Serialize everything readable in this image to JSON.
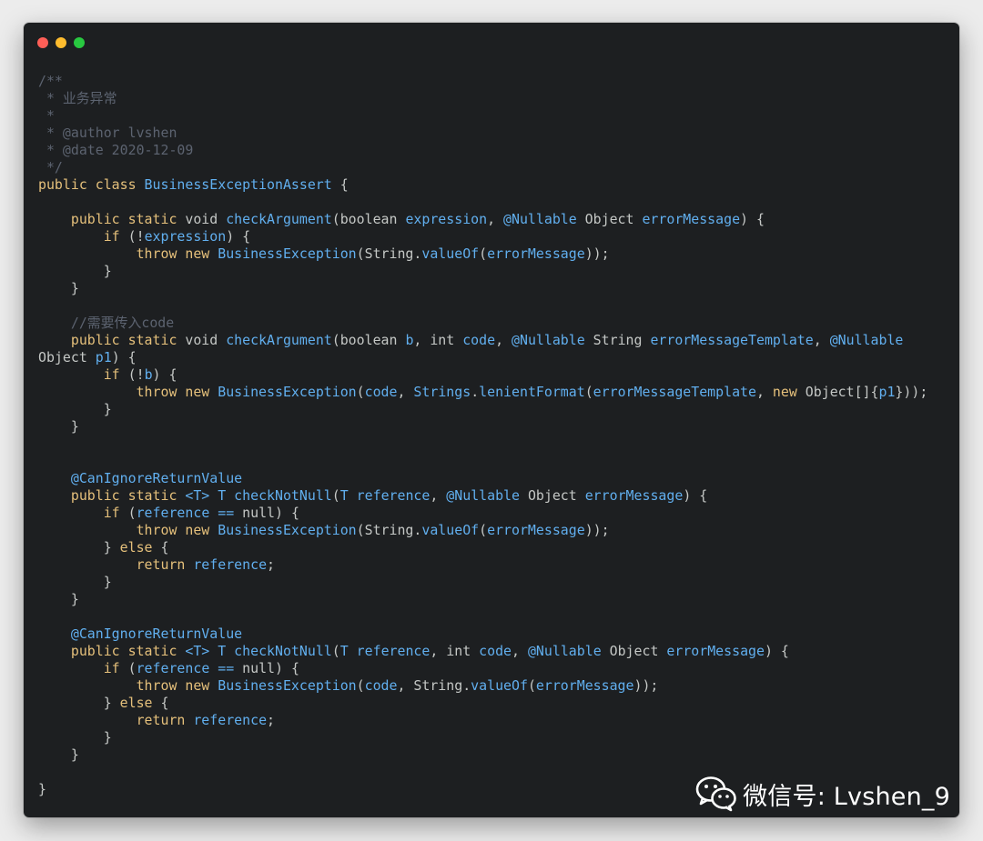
{
  "window": {
    "traffic_lights": [
      {
        "name": "close",
        "color": "#ff5f57"
      },
      {
        "name": "minimize",
        "color": "#febc2e"
      },
      {
        "name": "maximize",
        "color": "#28c840"
      }
    ]
  },
  "code_lines": [
    [
      {
        "t": "/**",
        "c": "comment"
      }
    ],
    [
      {
        "t": " * 业务异常",
        "c": "comment"
      }
    ],
    [
      {
        "t": " *",
        "c": "comment"
      }
    ],
    [
      {
        "t": " * @author lvshen",
        "c": "comment"
      }
    ],
    [
      {
        "t": " * @date 2020-12-09",
        "c": "comment"
      }
    ],
    [
      {
        "t": " */",
        "c": "comment"
      }
    ],
    [
      {
        "t": "public class ",
        "c": "kw"
      },
      {
        "t": "BusinessExceptionAssert",
        "c": "class"
      },
      {
        "t": " {",
        "c": "plain"
      }
    ],
    [],
    [
      {
        "t": "    public static ",
        "c": "kw"
      },
      {
        "t": "void ",
        "c": "type"
      },
      {
        "t": "checkArgument",
        "c": "method"
      },
      {
        "t": "(boolean ",
        "c": "plain"
      },
      {
        "t": "expression",
        "c": "param"
      },
      {
        "t": ", ",
        "c": "plain"
      },
      {
        "t": "@Nullable",
        "c": "ann"
      },
      {
        "t": " Object ",
        "c": "plain"
      },
      {
        "t": "errorMessage",
        "c": "param"
      },
      {
        "t": ") {",
        "c": "plain"
      }
    ],
    [
      {
        "t": "        if ",
        "c": "kw"
      },
      {
        "t": "(!",
        "c": "plain"
      },
      {
        "t": "expression",
        "c": "param"
      },
      {
        "t": ") {",
        "c": "plain"
      }
    ],
    [
      {
        "t": "            throw new ",
        "c": "kw"
      },
      {
        "t": "BusinessException",
        "c": "class"
      },
      {
        "t": "(String.",
        "c": "plain"
      },
      {
        "t": "valueOf",
        "c": "method"
      },
      {
        "t": "(",
        "c": "plain"
      },
      {
        "t": "errorMessage",
        "c": "param"
      },
      {
        "t": "));",
        "c": "plain"
      }
    ],
    [
      {
        "t": "        }",
        "c": "plain"
      }
    ],
    [
      {
        "t": "    }",
        "c": "plain"
      }
    ],
    [],
    [
      {
        "t": "    //需要传入code",
        "c": "comment"
      }
    ],
    [
      {
        "t": "    public static ",
        "c": "kw"
      },
      {
        "t": "void ",
        "c": "type"
      },
      {
        "t": "checkArgument",
        "c": "method"
      },
      {
        "t": "(boolean ",
        "c": "plain"
      },
      {
        "t": "b",
        "c": "param"
      },
      {
        "t": ", int ",
        "c": "plain"
      },
      {
        "t": "code",
        "c": "param"
      },
      {
        "t": ", ",
        "c": "plain"
      },
      {
        "t": "@Nullable",
        "c": "ann"
      },
      {
        "t": " String ",
        "c": "plain"
      },
      {
        "t": "errorMessageTemplate",
        "c": "param"
      },
      {
        "t": ", ",
        "c": "plain"
      },
      {
        "t": "@Nullable",
        "c": "ann"
      }
    ],
    [
      {
        "t": "Object ",
        "c": "plain"
      },
      {
        "t": "p1",
        "c": "param"
      },
      {
        "t": ") {",
        "c": "plain"
      }
    ],
    [
      {
        "t": "        if ",
        "c": "kw"
      },
      {
        "t": "(!",
        "c": "plain"
      },
      {
        "t": "b",
        "c": "param"
      },
      {
        "t": ") {",
        "c": "plain"
      }
    ],
    [
      {
        "t": "            throw new ",
        "c": "kw"
      },
      {
        "t": "BusinessException",
        "c": "class"
      },
      {
        "t": "(",
        "c": "plain"
      },
      {
        "t": "code",
        "c": "param"
      },
      {
        "t": ", ",
        "c": "plain"
      },
      {
        "t": "Strings",
        "c": "class"
      },
      {
        "t": ".",
        "c": "plain"
      },
      {
        "t": "lenientFormat",
        "c": "method"
      },
      {
        "t": "(",
        "c": "plain"
      },
      {
        "t": "errorMessageTemplate",
        "c": "param"
      },
      {
        "t": ", ",
        "c": "plain"
      },
      {
        "t": "new ",
        "c": "kw"
      },
      {
        "t": "Object[]{",
        "c": "plain"
      },
      {
        "t": "p1",
        "c": "param"
      },
      {
        "t": "}));",
        "c": "plain"
      }
    ],
    [
      {
        "t": "        }",
        "c": "plain"
      }
    ],
    [
      {
        "t": "    }",
        "c": "plain"
      }
    ],
    [],
    [],
    [
      {
        "t": "    @CanIgnoreReturnValue",
        "c": "ann"
      }
    ],
    [
      {
        "t": "    public static ",
        "c": "kw"
      },
      {
        "t": "<T> T ",
        "c": "class"
      },
      {
        "t": "checkNotNull",
        "c": "method"
      },
      {
        "t": "(",
        "c": "plain"
      },
      {
        "t": "T ",
        "c": "class"
      },
      {
        "t": "reference",
        "c": "param"
      },
      {
        "t": ", ",
        "c": "plain"
      },
      {
        "t": "@Nullable",
        "c": "ann"
      },
      {
        "t": " Object ",
        "c": "plain"
      },
      {
        "t": "errorMessage",
        "c": "param"
      },
      {
        "t": ") {",
        "c": "plain"
      }
    ],
    [
      {
        "t": "        if ",
        "c": "kw"
      },
      {
        "t": "(",
        "c": "plain"
      },
      {
        "t": "reference",
        "c": "param"
      },
      {
        "t": " == ",
        "c": "param"
      },
      {
        "t": "null) {",
        "c": "plain"
      }
    ],
    [
      {
        "t": "            throw new ",
        "c": "kw"
      },
      {
        "t": "BusinessException",
        "c": "class"
      },
      {
        "t": "(String.",
        "c": "plain"
      },
      {
        "t": "valueOf",
        "c": "method"
      },
      {
        "t": "(",
        "c": "plain"
      },
      {
        "t": "errorMessage",
        "c": "param"
      },
      {
        "t": "));",
        "c": "plain"
      }
    ],
    [
      {
        "t": "        } ",
        "c": "plain"
      },
      {
        "t": "else ",
        "c": "kw"
      },
      {
        "t": "{",
        "c": "plain"
      }
    ],
    [
      {
        "t": "            return ",
        "c": "kw"
      },
      {
        "t": "reference",
        "c": "param"
      },
      {
        "t": ";",
        "c": "plain"
      }
    ],
    [
      {
        "t": "        }",
        "c": "plain"
      }
    ],
    [
      {
        "t": "    }",
        "c": "plain"
      }
    ],
    [],
    [
      {
        "t": "    @CanIgnoreReturnValue",
        "c": "ann"
      }
    ],
    [
      {
        "t": "    public static ",
        "c": "kw"
      },
      {
        "t": "<T> T ",
        "c": "class"
      },
      {
        "t": "checkNotNull",
        "c": "method"
      },
      {
        "t": "(",
        "c": "plain"
      },
      {
        "t": "T ",
        "c": "class"
      },
      {
        "t": "reference",
        "c": "param"
      },
      {
        "t": ", int ",
        "c": "plain"
      },
      {
        "t": "code",
        "c": "param"
      },
      {
        "t": ", ",
        "c": "plain"
      },
      {
        "t": "@Nullable",
        "c": "ann"
      },
      {
        "t": " Object ",
        "c": "plain"
      },
      {
        "t": "errorMessage",
        "c": "param"
      },
      {
        "t": ") {",
        "c": "plain"
      }
    ],
    [
      {
        "t": "        if ",
        "c": "kw"
      },
      {
        "t": "(",
        "c": "plain"
      },
      {
        "t": "reference",
        "c": "param"
      },
      {
        "t": " == ",
        "c": "param"
      },
      {
        "t": "null) {",
        "c": "plain"
      }
    ],
    [
      {
        "t": "            throw new ",
        "c": "kw"
      },
      {
        "t": "BusinessException",
        "c": "class"
      },
      {
        "t": "(",
        "c": "plain"
      },
      {
        "t": "code",
        "c": "param"
      },
      {
        "t": ", String.",
        "c": "plain"
      },
      {
        "t": "valueOf",
        "c": "method"
      },
      {
        "t": "(",
        "c": "plain"
      },
      {
        "t": "errorMessage",
        "c": "param"
      },
      {
        "t": "));",
        "c": "plain"
      }
    ],
    [
      {
        "t": "        } ",
        "c": "plain"
      },
      {
        "t": "else ",
        "c": "kw"
      },
      {
        "t": "{",
        "c": "plain"
      }
    ],
    [
      {
        "t": "            return ",
        "c": "kw"
      },
      {
        "t": "reference",
        "c": "param"
      },
      {
        "t": ";",
        "c": "plain"
      }
    ],
    [
      {
        "t": "        }",
        "c": "plain"
      }
    ],
    [
      {
        "t": "    }",
        "c": "plain"
      }
    ],
    [],
    [
      {
        "t": "}",
        "c": "plain"
      }
    ]
  ],
  "watermark": {
    "icon": "wechat-icon",
    "text": "微信号: Lvshen_9"
  },
  "colors": {
    "background": "#1d1f21",
    "comment": "#5c6370",
    "keyword": "#e5c07b",
    "identifier": "#61afef",
    "plain": "#c5c8c6"
  }
}
